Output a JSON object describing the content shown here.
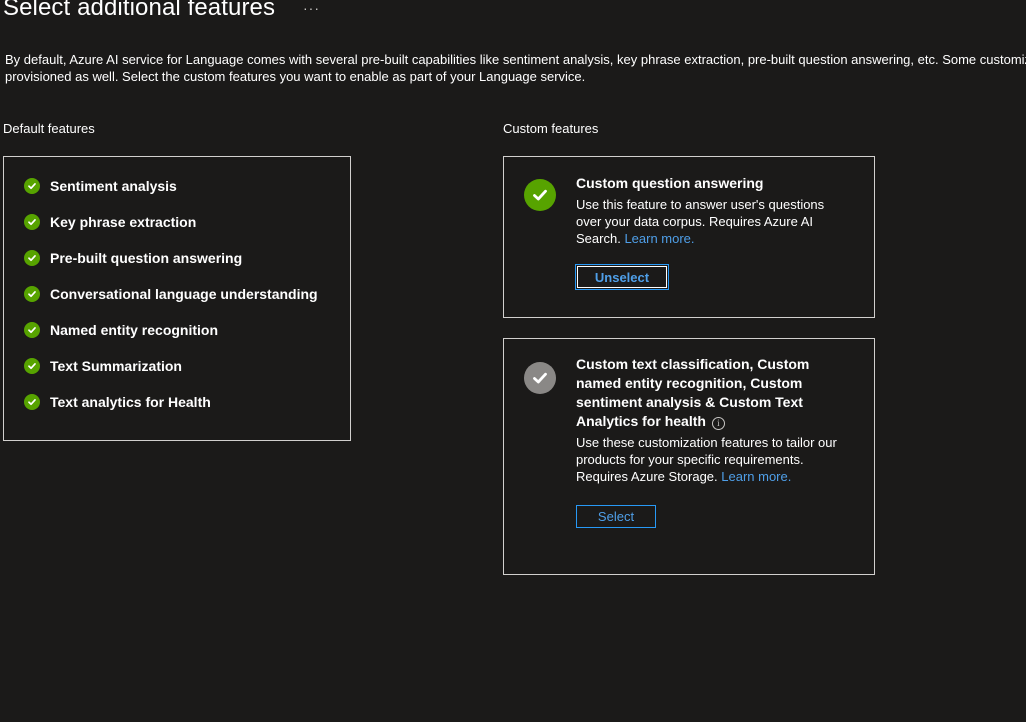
{
  "header": {
    "title": "Select additional features",
    "more_label": "···"
  },
  "description": {
    "line1": "By default, Azure AI service for Language comes with several pre-built capabilities like sentiment analysis, key phrase extraction, pre-built question answering, etc. Some customiza",
    "line2": "provisioned as well. Select the custom features you want to enable as part of your Language service."
  },
  "default_features": {
    "label": "Default features",
    "items": [
      "Sentiment analysis",
      "Key phrase extraction",
      "Pre-built question answering",
      "Conversational language understanding",
      "Named entity recognition",
      "Text Summarization",
      "Text analytics for Health"
    ]
  },
  "custom_features": {
    "label": "Custom features",
    "cards": [
      {
        "title": "Custom question answering",
        "desc": "Use this feature to answer user's questions over your data corpus. Requires Azure AI Search.",
        "link": "Learn more.",
        "button": "Unselect",
        "selected": true
      },
      {
        "title": "Custom text classification, Custom named entity recognition, Custom sentiment analysis & Custom Text Analytics for health",
        "info_glyph": "i",
        "desc": "Use these customization features to tailor our products for your specific requirements. Requires Azure Storage.",
        "link": "Learn more.",
        "button": "Select",
        "selected": false
      }
    ]
  },
  "colors": {
    "background": "#1b1a19",
    "check_green": "#57a300",
    "check_gray": "#8a8886",
    "link_blue": "#4f9fe8",
    "border": "#d2d0ce"
  },
  "icons": {
    "feature_check": "checkmark-circle-icon",
    "selected_check": "checkmark-circle-icon",
    "unselected_check": "checkmark-circle-icon",
    "info": "info-icon"
  }
}
